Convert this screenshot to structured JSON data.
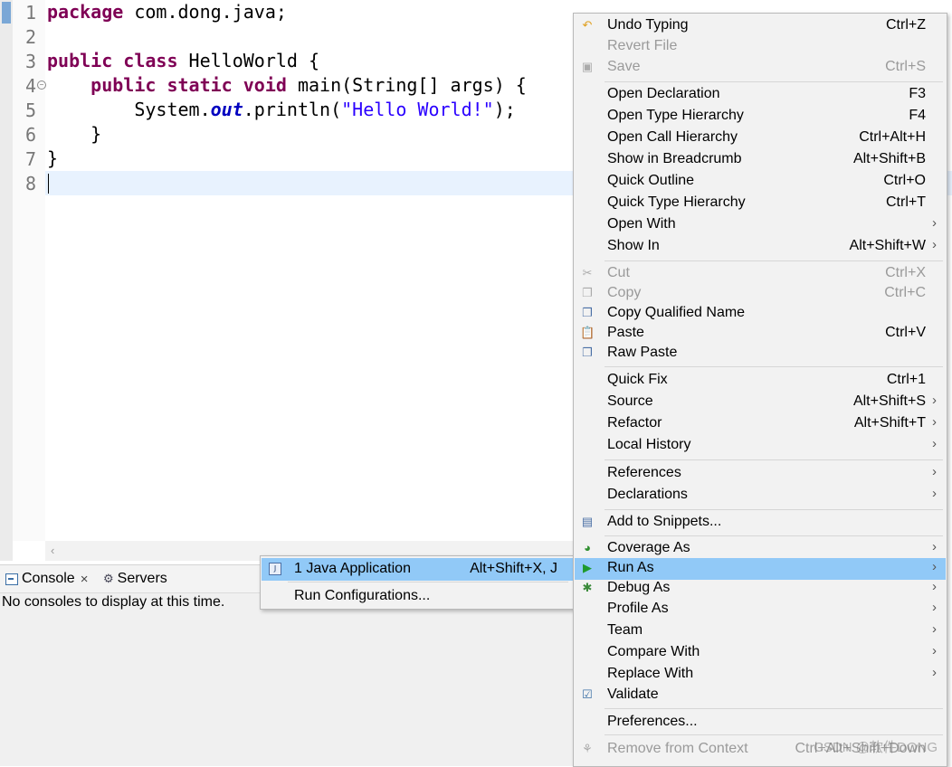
{
  "editor": {
    "line_numbers": [
      "1",
      "2",
      "3",
      "4",
      "5",
      "6",
      "7",
      "8"
    ],
    "line1": {
      "kw": "package",
      "rest": " com.dong.java;"
    },
    "line3": {
      "kw": "public class",
      "rest": " HelloWorld {"
    },
    "line4": {
      "kw": "public static void",
      "rest1": " main(String[] ",
      "param": "args",
      "rest2": ") {"
    },
    "line5": {
      "pre": "System.",
      "field": "out",
      "mid": ".println(",
      "str": "\"Hello World!\"",
      "post": ");"
    },
    "line6": "}",
    "line7": "}"
  },
  "console": {
    "tab_console": "Console",
    "tab_servers": "Servers",
    "message": "No consoles to display at this time."
  },
  "submenu": {
    "items": [
      {
        "label": "1 Java Application",
        "shortcut": "Alt+Shift+X, J"
      },
      {
        "label": "Run Configurations..."
      }
    ]
  },
  "context_menu": {
    "items": [
      {
        "label": "Undo Typing",
        "shortcut": "Ctrl+Z"
      },
      {
        "label": "Revert File"
      },
      {
        "label": "Save",
        "shortcut": "Ctrl+S"
      },
      {
        "label": "Open Declaration",
        "shortcut": "F3"
      },
      {
        "label": "Open Type Hierarchy",
        "shortcut": "F4"
      },
      {
        "label": "Open Call Hierarchy",
        "shortcut": "Ctrl+Alt+H"
      },
      {
        "label": "Show in Breadcrumb",
        "shortcut": "Alt+Shift+B"
      },
      {
        "label": "Quick Outline",
        "shortcut": "Ctrl+O"
      },
      {
        "label": "Quick Type Hierarchy",
        "shortcut": "Ctrl+T"
      },
      {
        "label": "Open With"
      },
      {
        "label": "Show In",
        "shortcut": "Alt+Shift+W"
      },
      {
        "label": "Cut",
        "shortcut": "Ctrl+X"
      },
      {
        "label": "Copy",
        "shortcut": "Ctrl+C"
      },
      {
        "label": "Copy Qualified Name"
      },
      {
        "label": "Paste",
        "shortcut": "Ctrl+V"
      },
      {
        "label": "Raw Paste"
      },
      {
        "label": "Quick Fix",
        "shortcut": "Ctrl+1"
      },
      {
        "label": "Source",
        "shortcut": "Alt+Shift+S"
      },
      {
        "label": "Refactor",
        "shortcut": "Alt+Shift+T"
      },
      {
        "label": "Local History"
      },
      {
        "label": "References"
      },
      {
        "label": "Declarations"
      },
      {
        "label": "Add to Snippets..."
      },
      {
        "label": "Coverage As"
      },
      {
        "label": "Run As"
      },
      {
        "label": "Debug As"
      },
      {
        "label": "Profile As"
      },
      {
        "label": "Team"
      },
      {
        "label": "Compare With"
      },
      {
        "label": "Replace With"
      },
      {
        "label": "Validate"
      },
      {
        "label": "Preferences..."
      },
      {
        "label": "Remove from Context",
        "shortcut": "Ctrl+Alt+Shift+Down"
      }
    ]
  },
  "watermark": "CSDN @软件DONG",
  "colors": {
    "keyword": "#7f0055",
    "string": "#2a00ff",
    "field": "#0000c0",
    "highlight": "#91c9f7",
    "current_line": "#e8f2fe"
  }
}
